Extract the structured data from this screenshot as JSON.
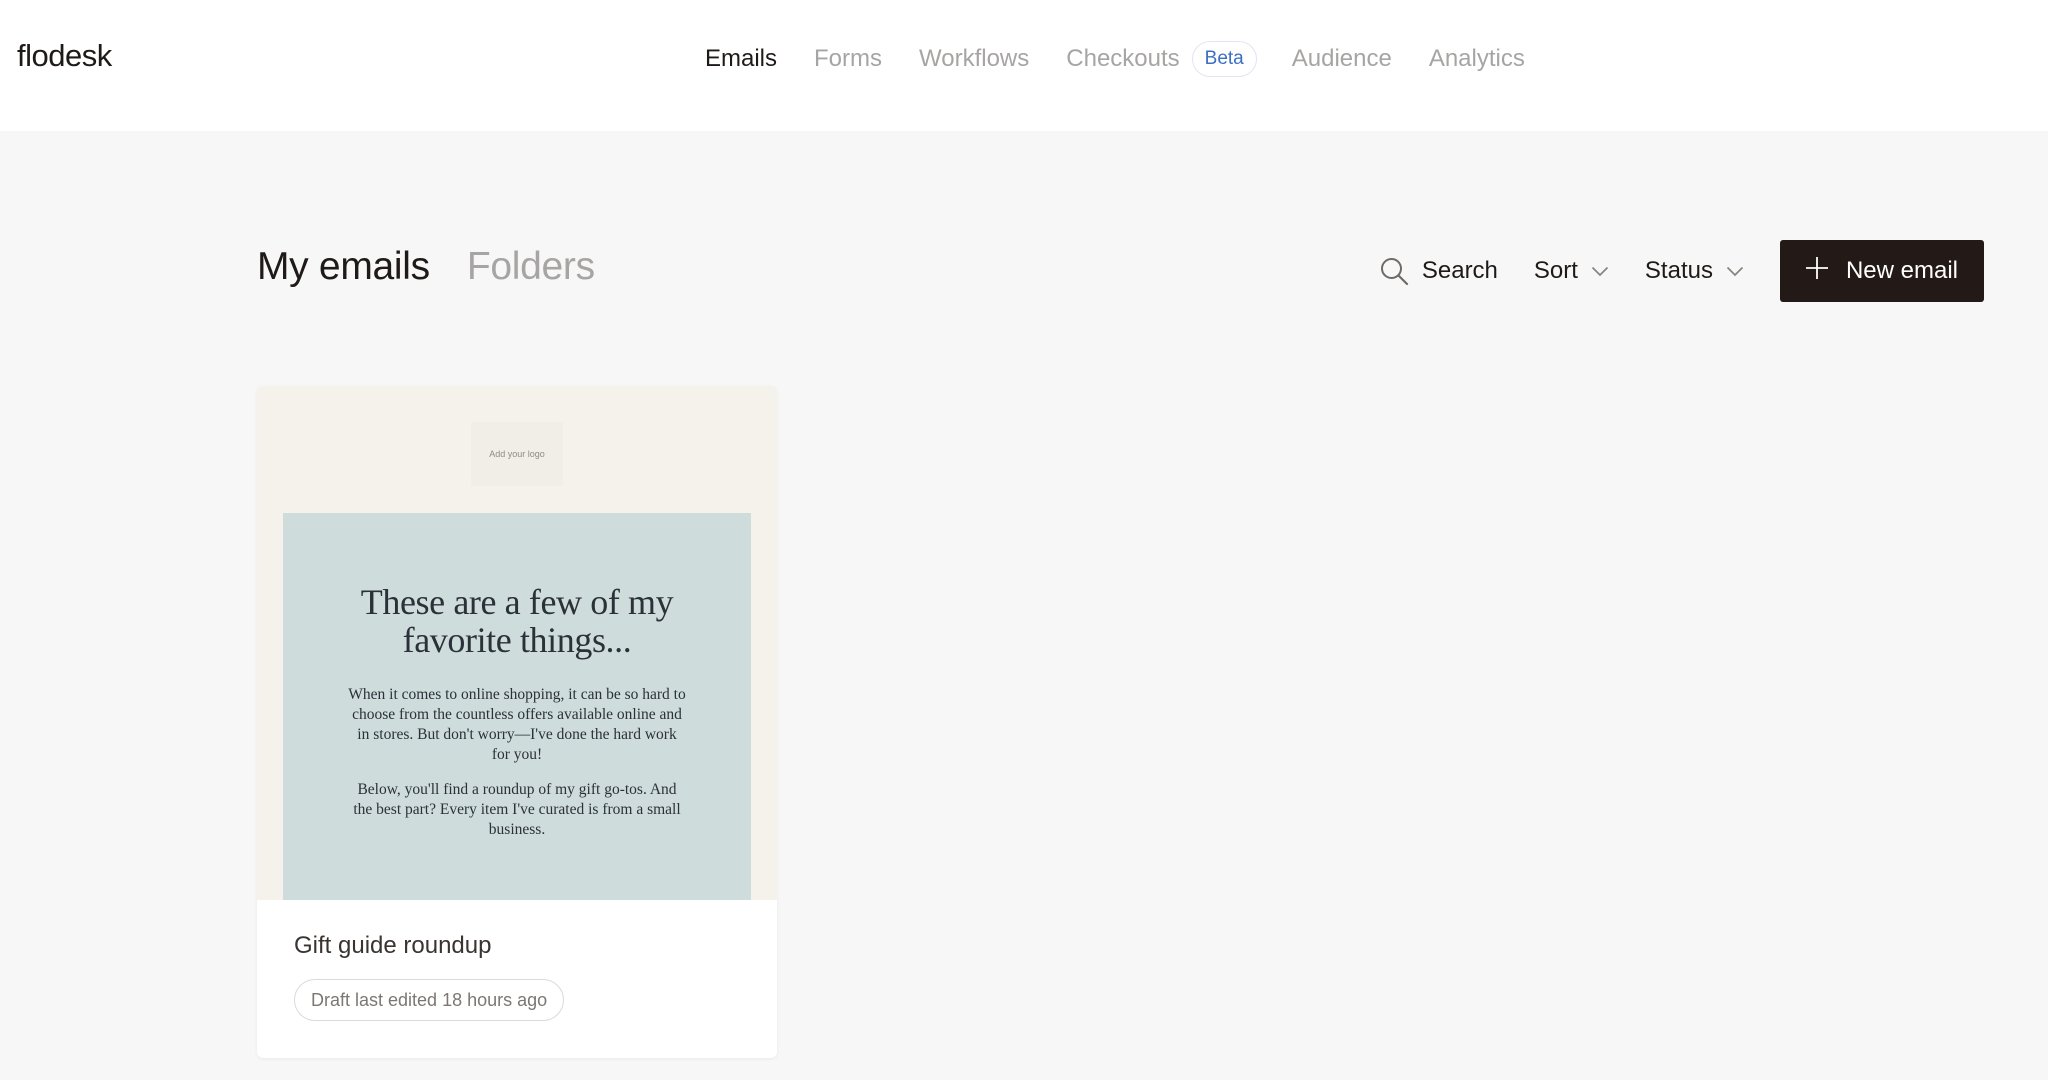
{
  "app": {
    "logo": "flodesk"
  },
  "nav": {
    "items": [
      {
        "label": "Emails",
        "active": true
      },
      {
        "label": "Forms",
        "active": false
      },
      {
        "label": "Workflows",
        "active": false
      },
      {
        "label": "Checkouts",
        "active": false,
        "badge": "Beta"
      },
      {
        "label": "Audience",
        "active": false
      },
      {
        "label": "Analytics",
        "active": false
      }
    ]
  },
  "tabs": [
    {
      "label": "My emails",
      "active": true
    },
    {
      "label": "Folders",
      "active": false
    }
  ],
  "toolbar": {
    "search_label": "Search",
    "sort_label": "Sort",
    "status_label": "Status",
    "new_email_label": "New email"
  },
  "emails": [
    {
      "title": "Gift guide roundup",
      "status": "Draft last edited 18 hours ago",
      "preview": {
        "logo_placeholder": "Add your logo",
        "heading": "These are a few of my favorite things...",
        "paragraph1": "When it comes to online shopping, it can be so hard to choose from the countless offers available online and in stores. But don't worry—I've done the hard work for you!",
        "paragraph2": "Below, you'll find a roundup of my gift go-tos. And the best part? Every item I've curated is from a small business."
      }
    }
  ],
  "colors": {
    "page_bg": "#f7f7f7",
    "header_bg": "#ffffff",
    "text_primary": "#1f1a17",
    "text_muted": "#a7a5a4",
    "button_bg": "#231917",
    "beta_text": "#3a6fc4",
    "preview_bg": "#f5f2ec",
    "hero_bg": "#cfdcdc"
  },
  "icons": {
    "search": "search-icon",
    "sort_chevron": "chevron-down-icon",
    "status_chevron": "chevron-down-icon",
    "new_email": "plus-icon"
  }
}
